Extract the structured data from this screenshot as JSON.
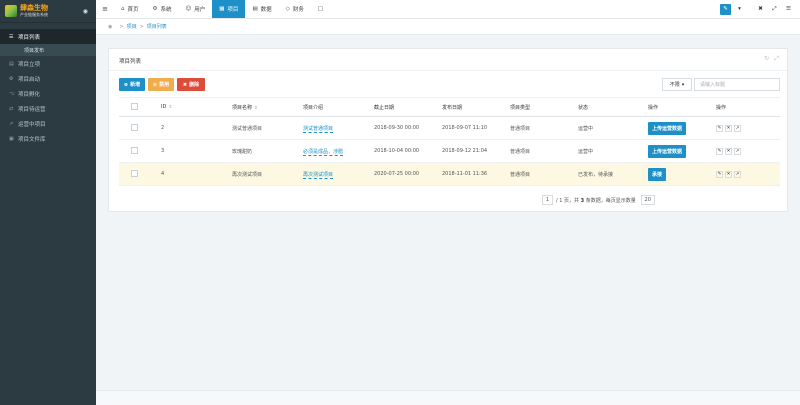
{
  "brand": {
    "title": "肆森生物",
    "subtitle": "产业链服务系统"
  },
  "sidebar": {
    "items": [
      {
        "label": "项目列表",
        "icon": "list-icon",
        "active": true
      },
      {
        "label": "项目发布",
        "sub": true
      },
      {
        "label": "项目立项",
        "icon": "file-icon"
      },
      {
        "label": "项目启动",
        "icon": "gear-icon"
      },
      {
        "label": "项目孵化",
        "icon": "share-icon"
      },
      {
        "label": "项目待运营",
        "icon": "shuffle-icon"
      },
      {
        "label": "运营中项目",
        "icon": "chart-icon"
      },
      {
        "label": "项目文件库",
        "icon": "folder-icon"
      }
    ]
  },
  "topnav": {
    "tabs": [
      {
        "label": "首页",
        "icon": "home-icon"
      },
      {
        "label": "系统",
        "icon": "gear-icon"
      },
      {
        "label": "用户",
        "icon": "user-icon"
      },
      {
        "label": "项目",
        "icon": "grid-icon",
        "active": true
      },
      {
        "label": "数据",
        "icon": "database-icon"
      },
      {
        "label": "财务",
        "icon": "diamond-icon"
      },
      {
        "label": "",
        "icon": "window-icon"
      }
    ]
  },
  "breadcrumb": {
    "items": [
      "项目",
      "项目列表"
    ]
  },
  "panel": {
    "title": "项目列表",
    "buttons": {
      "add": "新增",
      "disable": "禁用",
      "delete": "删除"
    },
    "filter": "不限",
    "search_placeholder": "请输入标题"
  },
  "table": {
    "headers": [
      "ID",
      "项目名称",
      "项目介绍",
      "截止日期",
      "发布日期",
      "项目类型",
      "状态",
      "操作",
      "操作"
    ],
    "rows": [
      {
        "id": "2",
        "name": "测试普通项目",
        "intro": "测试普通项目",
        "deadline": "2018-09-30 00:00",
        "published": "2018-09-07 11:10",
        "type": "普通项目",
        "status": "运营中",
        "action": "上传运营数据",
        "highlight": false
      },
      {
        "id": "3",
        "name": "玫瑰甜奶",
        "intro": "必须是成品，涉腊",
        "deadline": "2018-10-04 00:00",
        "published": "2018-09-12 21:04",
        "type": "普通项目",
        "status": "运营中",
        "action": "上传运营数据",
        "highlight": false
      },
      {
        "id": "4",
        "name": "再次测试项目",
        "intro": "再次测试项目",
        "deadline": "2020-07-25 00:00",
        "published": "2018-11-01 11:36",
        "type": "普通项目",
        "status": "已发布，待承接",
        "action": "承接",
        "highlight": true
      }
    ]
  },
  "pagination": {
    "current": "1",
    "text_pre": "/ 1 页，共",
    "total": "3",
    "text_post": "条数据，每页显示数量",
    "page_size": "20"
  },
  "colors": {
    "primary": "#1e90c8",
    "warning": "#f0ad4e",
    "danger": "#dd4b39",
    "sidebar": "#2c3b41"
  }
}
